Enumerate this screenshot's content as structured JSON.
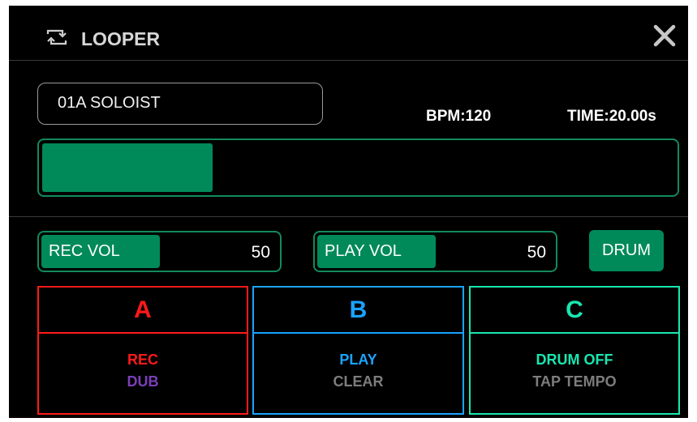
{
  "header": {
    "title": "LOOPER",
    "icon": "loop-icon",
    "close_icon": "close-icon"
  },
  "preset": {
    "name": "01A SOLOIST"
  },
  "status": {
    "bpm": "BPM:120",
    "time": "TIME:20.00s"
  },
  "progress": {
    "fraction": 0.27
  },
  "controls": {
    "rec_vol": {
      "label": "REC VOL",
      "value": "50",
      "fraction": 0.5
    },
    "play_vol": {
      "label": "PLAY VOL",
      "value": "50",
      "fraction": 0.5
    },
    "drum_label": "DRUM"
  },
  "tracks": [
    {
      "letter": "A",
      "action1": "REC",
      "action2": "DUB",
      "color": "#ff1a1a",
      "action1_color": "#ff1a1a",
      "action2_color": "#7b3fb8"
    },
    {
      "letter": "B",
      "action1": "PLAY",
      "action2": "CLEAR",
      "color": "#1aa3ff",
      "action1_color": "#1aa3ff",
      "action2_color": "#7d7d7d"
    },
    {
      "letter": "C",
      "action1": "DRUM OFF",
      "action2": "TAP TEMPO",
      "color": "#19e6b0",
      "action1_color": "#19e6b0",
      "action2_color": "#7d7d7d"
    }
  ],
  "colors": {
    "accent": "#008a5a",
    "accent_border": "#138a5c",
    "background": "#000000"
  }
}
